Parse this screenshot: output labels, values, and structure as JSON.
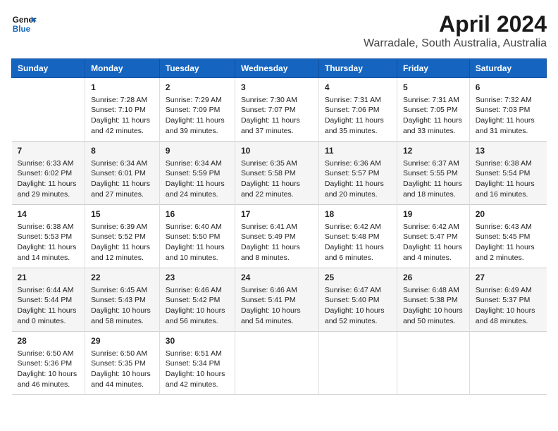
{
  "header": {
    "logo_line1": "General",
    "logo_line2": "Blue",
    "title": "April 2024",
    "subtitle": "Warradale, South Australia, Australia"
  },
  "calendar": {
    "days_of_week": [
      "Sunday",
      "Monday",
      "Tuesday",
      "Wednesday",
      "Thursday",
      "Friday",
      "Saturday"
    ],
    "weeks": [
      [
        {
          "day": "",
          "sunrise": "",
          "sunset": "",
          "daylight": ""
        },
        {
          "day": "1",
          "sunrise": "Sunrise: 7:28 AM",
          "sunset": "Sunset: 7:10 PM",
          "daylight": "Daylight: 11 hours and 42 minutes."
        },
        {
          "day": "2",
          "sunrise": "Sunrise: 7:29 AM",
          "sunset": "Sunset: 7:09 PM",
          "daylight": "Daylight: 11 hours and 39 minutes."
        },
        {
          "day": "3",
          "sunrise": "Sunrise: 7:30 AM",
          "sunset": "Sunset: 7:07 PM",
          "daylight": "Daylight: 11 hours and 37 minutes."
        },
        {
          "day": "4",
          "sunrise": "Sunrise: 7:31 AM",
          "sunset": "Sunset: 7:06 PM",
          "daylight": "Daylight: 11 hours and 35 minutes."
        },
        {
          "day": "5",
          "sunrise": "Sunrise: 7:31 AM",
          "sunset": "Sunset: 7:05 PM",
          "daylight": "Daylight: 11 hours and 33 minutes."
        },
        {
          "day": "6",
          "sunrise": "Sunrise: 7:32 AM",
          "sunset": "Sunset: 7:03 PM",
          "daylight": "Daylight: 11 hours and 31 minutes."
        }
      ],
      [
        {
          "day": "7",
          "sunrise": "Sunrise: 6:33 AM",
          "sunset": "Sunset: 6:02 PM",
          "daylight": "Daylight: 11 hours and 29 minutes."
        },
        {
          "day": "8",
          "sunrise": "Sunrise: 6:34 AM",
          "sunset": "Sunset: 6:01 PM",
          "daylight": "Daylight: 11 hours and 27 minutes."
        },
        {
          "day": "9",
          "sunrise": "Sunrise: 6:34 AM",
          "sunset": "Sunset: 5:59 PM",
          "daylight": "Daylight: 11 hours and 24 minutes."
        },
        {
          "day": "10",
          "sunrise": "Sunrise: 6:35 AM",
          "sunset": "Sunset: 5:58 PM",
          "daylight": "Daylight: 11 hours and 22 minutes."
        },
        {
          "day": "11",
          "sunrise": "Sunrise: 6:36 AM",
          "sunset": "Sunset: 5:57 PM",
          "daylight": "Daylight: 11 hours and 20 minutes."
        },
        {
          "day": "12",
          "sunrise": "Sunrise: 6:37 AM",
          "sunset": "Sunset: 5:55 PM",
          "daylight": "Daylight: 11 hours and 18 minutes."
        },
        {
          "day": "13",
          "sunrise": "Sunrise: 6:38 AM",
          "sunset": "Sunset: 5:54 PM",
          "daylight": "Daylight: 11 hours and 16 minutes."
        }
      ],
      [
        {
          "day": "14",
          "sunrise": "Sunrise: 6:38 AM",
          "sunset": "Sunset: 5:53 PM",
          "daylight": "Daylight: 11 hours and 14 minutes."
        },
        {
          "day": "15",
          "sunrise": "Sunrise: 6:39 AM",
          "sunset": "Sunset: 5:52 PM",
          "daylight": "Daylight: 11 hours and 12 minutes."
        },
        {
          "day": "16",
          "sunrise": "Sunrise: 6:40 AM",
          "sunset": "Sunset: 5:50 PM",
          "daylight": "Daylight: 11 hours and 10 minutes."
        },
        {
          "day": "17",
          "sunrise": "Sunrise: 6:41 AM",
          "sunset": "Sunset: 5:49 PM",
          "daylight": "Daylight: 11 hours and 8 minutes."
        },
        {
          "day": "18",
          "sunrise": "Sunrise: 6:42 AM",
          "sunset": "Sunset: 5:48 PM",
          "daylight": "Daylight: 11 hours and 6 minutes."
        },
        {
          "day": "19",
          "sunrise": "Sunrise: 6:42 AM",
          "sunset": "Sunset: 5:47 PM",
          "daylight": "Daylight: 11 hours and 4 minutes."
        },
        {
          "day": "20",
          "sunrise": "Sunrise: 6:43 AM",
          "sunset": "Sunset: 5:45 PM",
          "daylight": "Daylight: 11 hours and 2 minutes."
        }
      ],
      [
        {
          "day": "21",
          "sunrise": "Sunrise: 6:44 AM",
          "sunset": "Sunset: 5:44 PM",
          "daylight": "Daylight: 11 hours and 0 minutes."
        },
        {
          "day": "22",
          "sunrise": "Sunrise: 6:45 AM",
          "sunset": "Sunset: 5:43 PM",
          "daylight": "Daylight: 10 hours and 58 minutes."
        },
        {
          "day": "23",
          "sunrise": "Sunrise: 6:46 AM",
          "sunset": "Sunset: 5:42 PM",
          "daylight": "Daylight: 10 hours and 56 minutes."
        },
        {
          "day": "24",
          "sunrise": "Sunrise: 6:46 AM",
          "sunset": "Sunset: 5:41 PM",
          "daylight": "Daylight: 10 hours and 54 minutes."
        },
        {
          "day": "25",
          "sunrise": "Sunrise: 6:47 AM",
          "sunset": "Sunset: 5:40 PM",
          "daylight": "Daylight: 10 hours and 52 minutes."
        },
        {
          "day": "26",
          "sunrise": "Sunrise: 6:48 AM",
          "sunset": "Sunset: 5:38 PM",
          "daylight": "Daylight: 10 hours and 50 minutes."
        },
        {
          "day": "27",
          "sunrise": "Sunrise: 6:49 AM",
          "sunset": "Sunset: 5:37 PM",
          "daylight": "Daylight: 10 hours and 48 minutes."
        }
      ],
      [
        {
          "day": "28",
          "sunrise": "Sunrise: 6:50 AM",
          "sunset": "Sunset: 5:36 PM",
          "daylight": "Daylight: 10 hours and 46 minutes."
        },
        {
          "day": "29",
          "sunrise": "Sunrise: 6:50 AM",
          "sunset": "Sunset: 5:35 PM",
          "daylight": "Daylight: 10 hours and 44 minutes."
        },
        {
          "day": "30",
          "sunrise": "Sunrise: 6:51 AM",
          "sunset": "Sunset: 5:34 PM",
          "daylight": "Daylight: 10 hours and 42 minutes."
        },
        {
          "day": "",
          "sunrise": "",
          "sunset": "",
          "daylight": ""
        },
        {
          "day": "",
          "sunrise": "",
          "sunset": "",
          "daylight": ""
        },
        {
          "day": "",
          "sunrise": "",
          "sunset": "",
          "daylight": ""
        },
        {
          "day": "",
          "sunrise": "",
          "sunset": "",
          "daylight": ""
        }
      ]
    ]
  }
}
